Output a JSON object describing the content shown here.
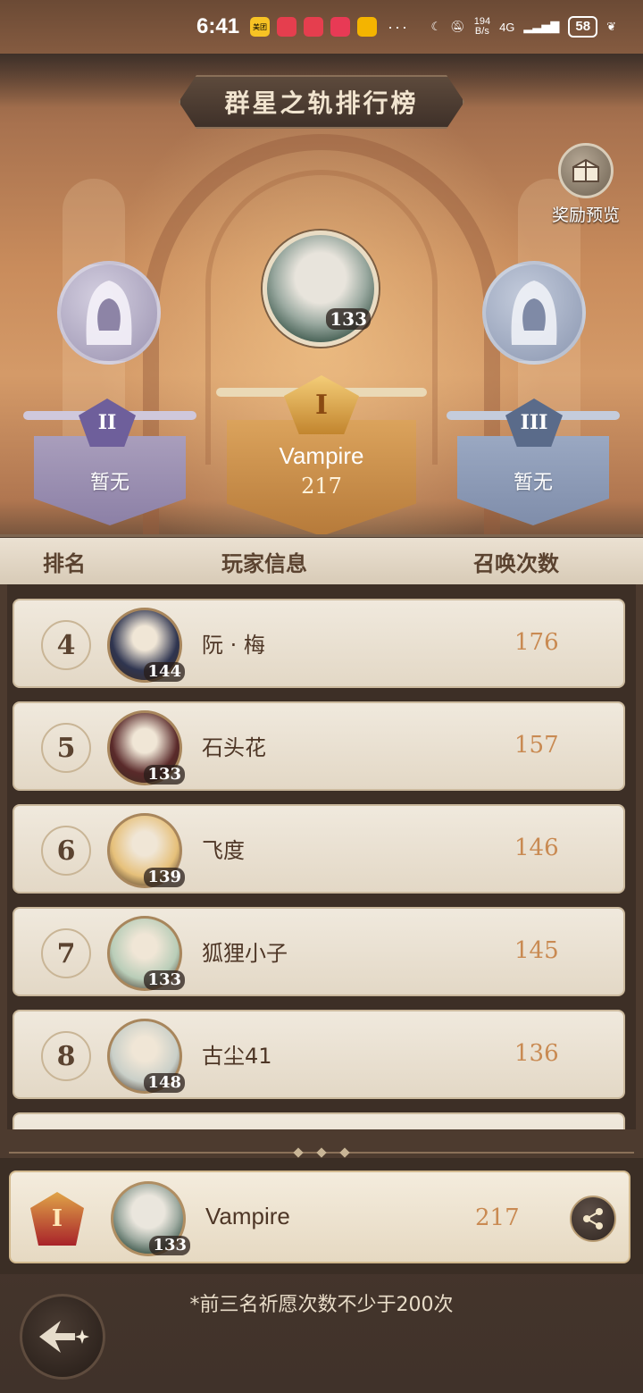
{
  "status_bar": {
    "time": "6:41",
    "apps": [
      {
        "name": "meituan-app-icon",
        "label": "美团",
        "color": "#f7c324"
      },
      {
        "name": "huawei-app-icon-1",
        "label": "HUAWEI",
        "color": "#e53e4e"
      },
      {
        "name": "huawei-app-icon-2",
        "label": "HUAWEI",
        "color": "#e53e4e"
      },
      {
        "name": "red-app-icon",
        "label": "",
        "color": "#e83a55"
      },
      {
        "name": "weibo-app-icon",
        "label": "",
        "color": "#f4b400"
      }
    ],
    "more": "···",
    "speed_value": "194",
    "speed_unit": "B/s",
    "network": "4G",
    "battery": "58"
  },
  "title": "群星之轨排行榜",
  "reward_preview": {
    "label": "奖励预览"
  },
  "podium": {
    "first": {
      "rank": "I",
      "name": "Vampire",
      "score": "217",
      "level": "133"
    },
    "second": {
      "rank": "II",
      "name": "暂无"
    },
    "third": {
      "rank": "III",
      "name": "暂无"
    }
  },
  "table": {
    "headers": {
      "rank": "排名",
      "player": "玩家信息",
      "count": "召唤次数"
    },
    "rows": [
      {
        "rank": "4",
        "name": "阮 · 梅",
        "level": "144",
        "count": "176",
        "avatar_color": "#2f3550"
      },
      {
        "rank": "5",
        "name": "石头花",
        "level": "133",
        "count": "157",
        "avatar_color": "#5a2a2a"
      },
      {
        "rank": "6",
        "name": "飞度",
        "level": "139",
        "count": "146",
        "avatar_color": "#e6c07a"
      },
      {
        "rank": "7",
        "name": "狐狸小子",
        "level": "133",
        "count": "145",
        "avatar_color": "#b9cdb8"
      },
      {
        "rank": "8",
        "name": "古尘41",
        "level": "148",
        "count": "136",
        "avatar_color": "#c9cfc8"
      }
    ]
  },
  "self": {
    "rank": "I",
    "name": "Vampire",
    "level": "133",
    "score": "217"
  },
  "note": "*前三名祈愿次数不少于200次"
}
